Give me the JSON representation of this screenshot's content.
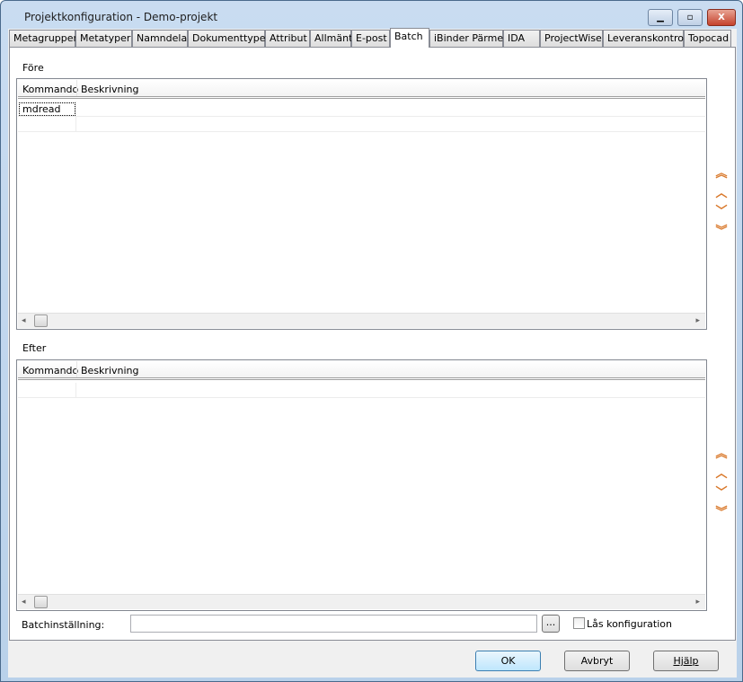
{
  "window": {
    "title": "Projektkonfiguration - Demo-projekt",
    "controls": [
      "minimize-icon",
      "maximize-icon",
      "close-icon"
    ]
  },
  "tabs": [
    {
      "label": "Metagrupper"
    },
    {
      "label": "Metatyper"
    },
    {
      "label": "Namndelar"
    },
    {
      "label": "Dokumenttyper"
    },
    {
      "label": "Attribut"
    },
    {
      "label": "Allmänt"
    },
    {
      "label": "E-post"
    },
    {
      "label": "Batch",
      "selected": true
    },
    {
      "label": "iBinder Pärmen"
    },
    {
      "label": "IDA"
    },
    {
      "label": "ProjectWise"
    },
    {
      "label": "Leveranskontroll"
    },
    {
      "label": "Topocad"
    }
  ],
  "fore": {
    "label": "Före",
    "columns": [
      "Kommando",
      "Beskrivning"
    ],
    "rows": [
      {
        "kommando": "mdread",
        "beskrivning": ""
      }
    ]
  },
  "efter": {
    "label": "Efter",
    "columns": [
      "Kommando",
      "Beskrivning"
    ],
    "rows": []
  },
  "move_icons": [
    "move-top-icon",
    "move-up-icon",
    "move-down-icon",
    "move-bottom-icon"
  ],
  "batch": {
    "label": "Batchinställning:",
    "value": "",
    "browse_label": "...",
    "lock_label": "Lås konfiguration",
    "lock_checked": false
  },
  "buttons": {
    "ok": "OK",
    "cancel": "Avbryt",
    "help": "Hjälp"
  },
  "colors": {
    "accent_arrows": "#d9782a"
  }
}
